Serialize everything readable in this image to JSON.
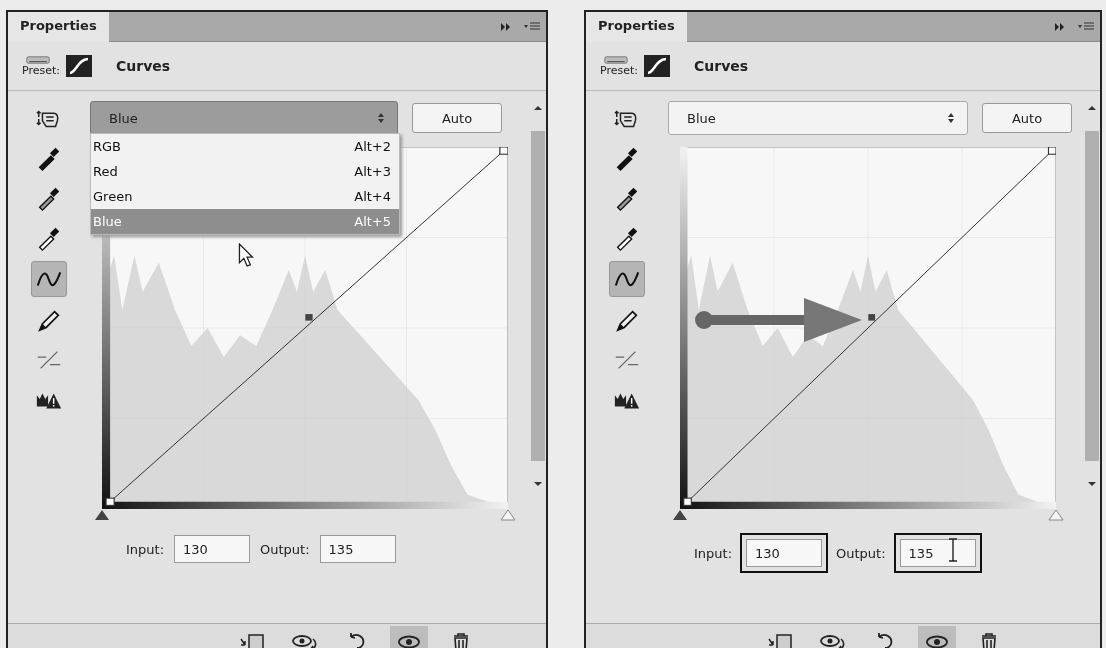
{
  "panels": [
    {
      "tab": "Properties",
      "preset_label": "Preset:",
      "title": "Curves",
      "channel": "Blue",
      "auto": "Auto",
      "tools": [
        {
          "kind": "hand",
          "selected": false
        },
        {
          "kind": "black-dropper",
          "selected": false
        },
        {
          "kind": "gray-dropper",
          "selected": false
        },
        {
          "kind": "white-dropper",
          "selected": false
        },
        {
          "kind": "curve",
          "selected": true
        },
        {
          "kind": "pencil",
          "selected": false
        },
        {
          "kind": "smooth",
          "selected": false
        },
        {
          "kind": "clip-warning",
          "selected": false
        }
      ],
      "menu": [
        {
          "label": "RGB",
          "shortcut": "Alt+2",
          "selected": false
        },
        {
          "label": "Red",
          "shortcut": "Alt+3",
          "selected": false
        },
        {
          "label": "Green",
          "shortcut": "Alt+4",
          "selected": false
        },
        {
          "label": "Blue",
          "shortcut": "Alt+5",
          "selected": true
        }
      ],
      "pointer_cursor": true,
      "input_label": "Input:",
      "input": "130",
      "output_label": "Output:",
      "output": "135",
      "footer": [
        {
          "kind": "clip",
          "selected": false
        },
        {
          "kind": "view-previous",
          "selected": false
        },
        {
          "kind": "reset",
          "selected": false
        },
        {
          "kind": "visibility",
          "selected": true
        },
        {
          "kind": "delete",
          "selected": false
        }
      ]
    },
    {
      "tab": "Properties",
      "preset_label": "Preset:",
      "title": "Curves",
      "channel": "Blue",
      "auto": "Auto",
      "tools": [
        {
          "kind": "hand",
          "selected": false
        },
        {
          "kind": "black-dropper",
          "selected": false
        },
        {
          "kind": "gray-dropper",
          "selected": false
        },
        {
          "kind": "white-dropper",
          "selected": false
        },
        {
          "kind": "curve",
          "selected": true
        },
        {
          "kind": "pencil",
          "selected": false
        },
        {
          "kind": "smooth",
          "selected": false
        },
        {
          "kind": "clip-warning",
          "selected": false
        }
      ],
      "annotation_arrow": true,
      "fields_highlighted": true,
      "text_cursor": true,
      "input_label": "Input:",
      "input": "130",
      "output_label": "Output:",
      "output": "135",
      "footer": [
        {
          "kind": "clip",
          "selected": false
        },
        {
          "kind": "view-previous",
          "selected": false
        },
        {
          "kind": "reset",
          "selected": false
        },
        {
          "kind": "visibility",
          "selected": true
        },
        {
          "kind": "delete",
          "selected": false
        }
      ]
    }
  ]
}
